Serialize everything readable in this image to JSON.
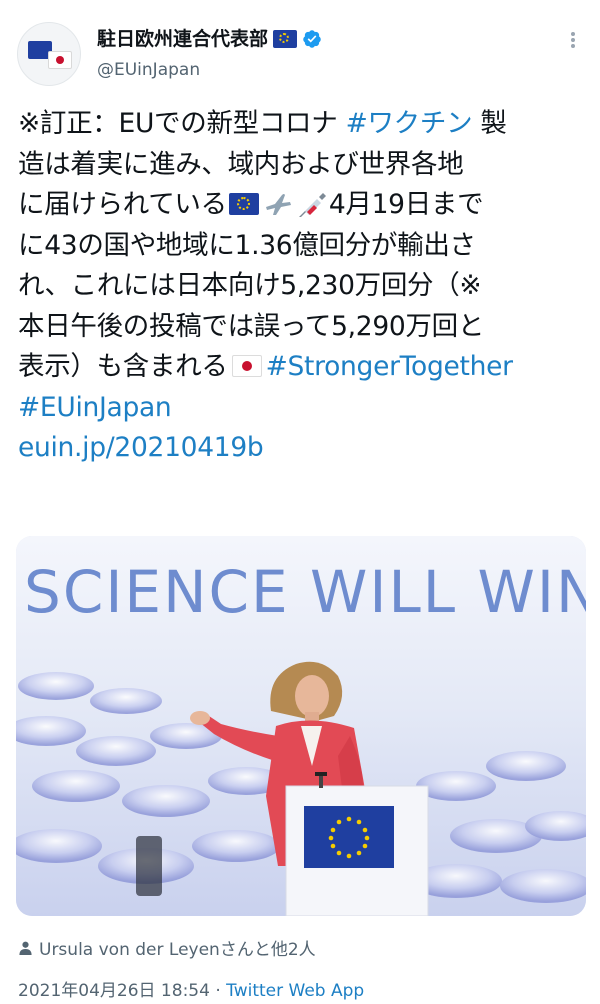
{
  "account": {
    "display_name": "駐日欧州連合代表部",
    "handle": "@EUinJapan",
    "verified": true
  },
  "tweet": {
    "lines": [
      [
        {
          "t": "※訂正：EUでの新型コロナ "
        },
        {
          "t": "#ワクチン",
          "link": true
        },
        {
          "t": " 製"
        }
      ],
      [
        {
          "t": "造は着実に進み、域内および世界各地"
        }
      ],
      [
        {
          "t": "に届けられている"
        },
        {
          "icon": "eu-flag-emoji"
        },
        {
          "icon": "airplane-emoji"
        },
        {
          "icon": "syringe-emoji"
        },
        {
          "t": "4月19日まで"
        }
      ],
      [
        {
          "t": "に43の国や地域に1.36億回分が輸出さ"
        }
      ],
      [
        {
          "t": "れ、これには日本向け5,230万回分（※"
        }
      ],
      [
        {
          "t": "本日午後の投稿では誤って5,290万回と"
        }
      ],
      [
        {
          "t": "表示）も含まれる"
        },
        {
          "icon": "japan-flag-emoji"
        },
        {
          "t": "#StrongerTogether",
          "link": true
        }
      ],
      [
        {
          "t": "#EUinJapan",
          "link": true
        }
      ],
      [
        {
          "t": "euin.jp/20210419b",
          "link": true
        }
      ]
    ]
  },
  "media": {
    "banner_text": "SCIENCE WILL WIN"
  },
  "tagged_people": "Ursula von der Leyenさんと他2人",
  "timestamp": "2021年04月26日 18:54",
  "separator": " · ",
  "source_app": "Twitter Web App",
  "colors": {
    "link": "#1d7fc4",
    "secondary_text": "#536471",
    "verified_badge": "#1d9bf0",
    "eu_blue": "#1f3fa0"
  }
}
